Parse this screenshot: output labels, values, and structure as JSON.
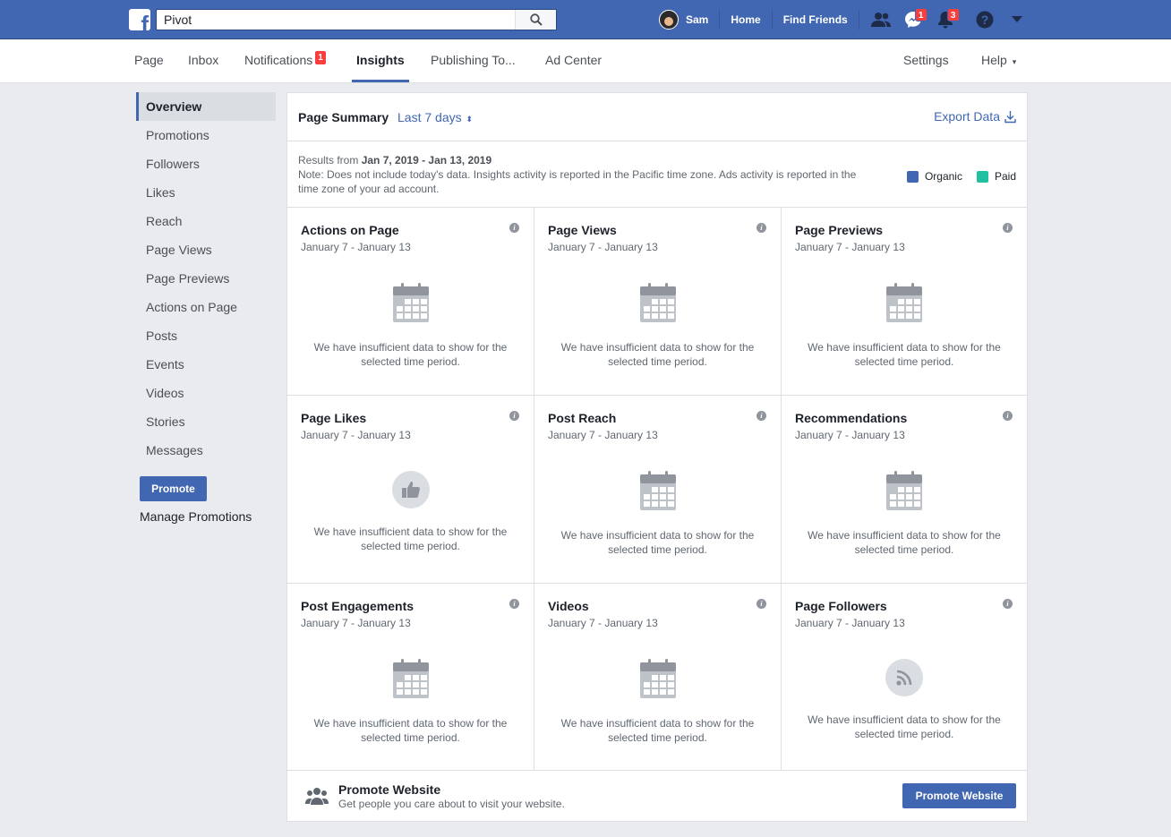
{
  "topbar": {
    "search_value": "Pivot",
    "user_name": "Sam",
    "links": [
      "Home",
      "Find Friends"
    ],
    "messages_count": "1",
    "notifications_count": "3",
    "icons": [
      "facebook-logo-icon",
      "search-icon",
      "friend-requests-icon",
      "messenger-icon",
      "notifications-bell-icon",
      "help-icon",
      "account-menu-chevron-icon"
    ]
  },
  "pagenav": {
    "items": [
      "Page",
      "Inbox",
      "Notifications",
      "Insights",
      "Publishing To...",
      "Ad Center"
    ],
    "notifications_badge": "1",
    "active": "Insights",
    "settings": "Settings",
    "help": "Help",
    "help_arrow": "▾"
  },
  "sidebar": {
    "items": [
      "Overview",
      "Promotions",
      "Followers",
      "Likes",
      "Reach",
      "Page Views",
      "Page Previews",
      "Actions on Page",
      "Posts",
      "Events",
      "Videos",
      "Stories",
      "Messages"
    ],
    "active": "Overview",
    "promote_button": "Promote",
    "manage_promotions": "Manage Promotions"
  },
  "summary": {
    "title": "Page Summary",
    "range": "Last 7 days",
    "range_arrow": "⬍",
    "export": "Export Data",
    "results_prefix": "Results from",
    "results_range": "Jan 7, 2019 - Jan 13, 2019",
    "note": "Note: Does not include today's data. Insights activity is reported in the Pacific time zone. Ads activity is reported in the time zone of your ad account.",
    "legend": [
      {
        "label": "Organic",
        "color": "#4267b2"
      },
      {
        "label": "Paid",
        "color": "#20c0a0"
      }
    ]
  },
  "cards": [
    {
      "title": "Actions on Page",
      "date": "January 7 - January 13",
      "icon": "calendar-icon",
      "message": "We have insufficient data to show for the selected time period."
    },
    {
      "title": "Page Views",
      "date": "January 7 - January 13",
      "icon": "calendar-icon",
      "message": "We have insufficient data to show for the selected time period."
    },
    {
      "title": "Page Previews",
      "date": "January 7 - January 13",
      "icon": "calendar-icon",
      "message": "We have insufficient data to show for the selected time period."
    },
    {
      "title": "Page Likes",
      "date": "January 7 - January 13",
      "icon": "thumbs-up-icon",
      "message": "We have insufficient data to show for the selected time period."
    },
    {
      "title": "Post Reach",
      "date": "January 7 - January 13",
      "icon": "calendar-icon",
      "message": "We have insufficient data to show for the selected time period."
    },
    {
      "title": "Recommendations",
      "date": "January 7 - January 13",
      "icon": "calendar-icon",
      "message": "We have insufficient data to show for the selected time period."
    },
    {
      "title": "Post Engagements",
      "date": "January 7 - January 13",
      "icon": "calendar-icon",
      "message": "We have insufficient data to show for the selected time period."
    },
    {
      "title": "Videos",
      "date": "January 7 - January 13",
      "icon": "calendar-icon",
      "message": "We have insufficient data to show for the selected time period."
    },
    {
      "title": "Page Followers",
      "date": "January 7 - January 13",
      "icon": "rss-feed-icon",
      "message": "We have insufficient data to show for the selected time period."
    }
  ],
  "info_glyph": "i",
  "promote_website": {
    "title": "Promote Website",
    "description": "Get people you care about to visit your website.",
    "button": "Promote Website",
    "icon": "people-group-icon"
  },
  "colors": {
    "brand_blue": "#4267b2",
    "paid_green": "#20c0a0",
    "badge_red": "#fa3e3e"
  }
}
